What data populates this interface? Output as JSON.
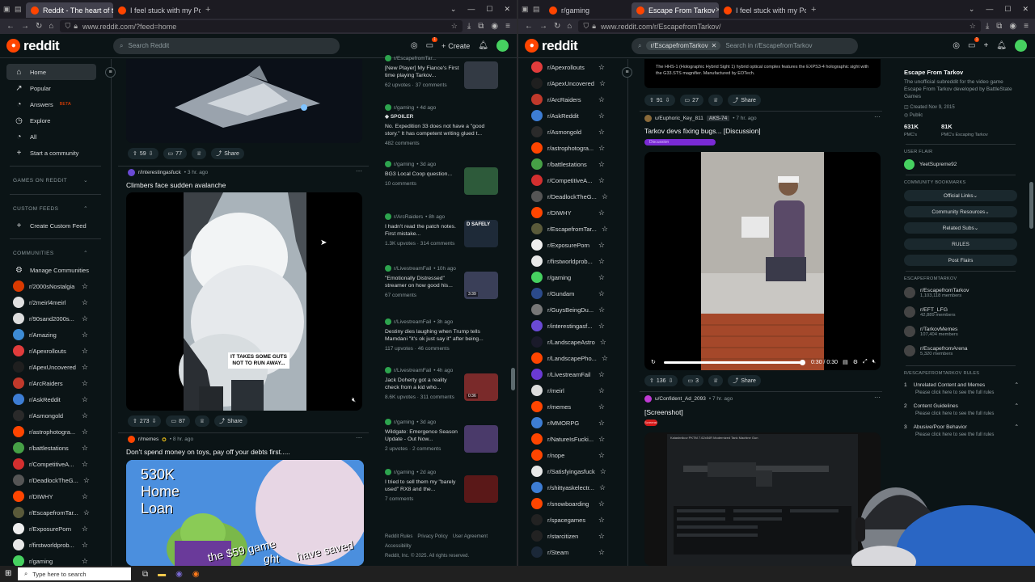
{
  "left": {
    "tabs": [
      {
        "label": "Reddit - The heart of the intern"
      },
      {
        "label": "I feel stuck with my Polaris..."
      }
    ],
    "url": "www.reddit.com/?feed=home",
    "logo": "reddit",
    "search_placeholder": "Search Reddit",
    "create_label": "Create",
    "notif_count": "1",
    "nav": [
      {
        "label": "Home",
        "icon": "home-icon"
      },
      {
        "label": "Popular",
        "icon": "popular-icon"
      },
      {
        "label": "Answers",
        "badge": "BETA",
        "icon": "answers-icon"
      },
      {
        "label": "Explore",
        "icon": "explore-icon"
      },
      {
        "label": "All",
        "icon": "all-icon"
      },
      {
        "label": "Start a community",
        "icon": "plus-icon"
      }
    ],
    "sections": {
      "games": "GAMES ON REDDIT",
      "custom_feeds": "CUSTOM FEEDS",
      "create_custom_feed": "Create Custom Feed",
      "communities": "COMMUNITIES",
      "manage": "Manage Communities"
    },
    "communities": [
      {
        "name": "r/2000sNostalgia",
        "color": "#d93a00"
      },
      {
        "name": "r/2meirl4meirl",
        "color": "#e0e0e0"
      },
      {
        "name": "r/90sand2000s...",
        "color": "#dddddd"
      },
      {
        "name": "r/Amazing",
        "color": "#3d8bd4"
      },
      {
        "name": "r/Apexrollouts",
        "color": "#e03c3c"
      },
      {
        "name": "r/ApexUncovered",
        "color": "#1f1f1f"
      },
      {
        "name": "r/ArcRaiders",
        "color": "#c0392b"
      },
      {
        "name": "r/AskReddit",
        "color": "#3d7dd4"
      },
      {
        "name": "r/Asmongold",
        "color": "#2a2a2a"
      },
      {
        "name": "r/astrophotogra...",
        "color": "#ff4500"
      },
      {
        "name": "r/battlestations",
        "color": "#46a046"
      },
      {
        "name": "r/CompetitiveA...",
        "color": "#d32f2f"
      },
      {
        "name": "r/DeadlockTheG...",
        "color": "#555555"
      },
      {
        "name": "r/DIWHY",
        "color": "#ff4500"
      },
      {
        "name": "r/EscapefromTar...",
        "color": "#5a5a3a"
      },
      {
        "name": "r/ExposurePorn",
        "color": "#eeeeee"
      },
      {
        "name": "r/firstworldprob...",
        "color": "#e8e8e8"
      },
      {
        "name": "r/gaming",
        "color": "#46d160"
      }
    ],
    "posts": [
      {
        "upvotes": "59",
        "comments": "77",
        "share": "Share"
      },
      {
        "sub": "r/interestingasfuck",
        "age": "• 3 hr. ago",
        "title": "Climbers face sudden avalanche",
        "caption": "IT TAKES SOME GUTS NOT TO RUN AWAY...",
        "upvotes": "273",
        "comments": "87",
        "share": "Share"
      },
      {
        "sub": "r/memes",
        "age": "• 8 hr. ago",
        "title": "Don't spend money on toys, pay off your debts first.....",
        "meme_lines": [
          "530K",
          "Home",
          "Loan"
        ],
        "meme_bottom": "the $59 game",
        "meme_right": "have saved",
        "meme_bottom2": "ght"
      }
    ],
    "rail": [
      {
        "sub": "r/EscapefromTar...",
        "title": "[New Player] My Fiance's First time playing Tarkov...",
        "stats": "62 upvotes · 37 comments",
        "thumb": "#333a44"
      },
      {
        "sub": "r/gaming",
        "age": "• 4d ago",
        "spoiler": "SPOILER",
        "title": "No. Expedition 33 does not have a \"good story.\" It has competent writing glued t...",
        "stats": "482 comments"
      },
      {
        "sub": "r/gaming",
        "age": "• 3d ago",
        "title": "BG3 Local Coop question...",
        "stats": "10 comments",
        "thumb": "#2d5a3a"
      },
      {
        "sub": "r/ArcRaiders",
        "age": "• 8h ago",
        "title": "I hadn't read the patch notes. First mistake...",
        "stats": "1.3K upvotes · 314 comments",
        "thumb": "#1e2a38",
        "thumb_text": "D SAFELY"
      },
      {
        "sub": "r/LivestreamFail",
        "age": "• 10h ago",
        "title": "\"Emotionally Distressed\" streamer on how good his...",
        "stats": "67 comments",
        "thumb": "#3a3f58",
        "dur": "3:39"
      },
      {
        "sub": "r/LivestreamFail",
        "age": "• 3h ago",
        "title": "Destiny dies laughing when Trump tells Mamdani \"it's ok just say it\" after being...",
        "stats": "117 upvotes · 46 comments"
      },
      {
        "sub": "r/LivestreamFail",
        "age": "• 4h ago",
        "title": "Jack Doherty got a reality check from a kid who...",
        "stats": "8.6K upvotes · 311 comments",
        "thumb": "#7a2a2a",
        "dur": "0:36"
      },
      {
        "sub": "r/gaming",
        "age": "• 3d ago",
        "title": "Wildgate: Emergence Season Update - Out Now...",
        "stats": "2 upvotes · 2 comments",
        "thumb": "#4a3a6a"
      },
      {
        "sub": "r/gaming",
        "age": "• 2d ago",
        "title": "I tried to sell them my \"barely used\" RX8 and the...",
        "stats": "7 comments",
        "thumb": "#5a1818"
      }
    ],
    "footer": {
      "links": [
        "Reddit Rules",
        "Privacy Policy",
        "User Agreement",
        "Accessibility"
      ],
      "copyright": "Reddit, Inc. © 2025. All rights reserved."
    }
  },
  "right": {
    "tabs": [
      {
        "label": "r/gaming"
      },
      {
        "label": "Escape From Tarkov"
      },
      {
        "label": "I feel stuck with my Polaris..."
      }
    ],
    "url": "www.reddit.com/r/EscapefromTarkov/",
    "logo": "reddit",
    "search_chip": "r/EscapefromTarkov",
    "search_placeholder": "Search in r/EscapefromTarkov",
    "notif_count": "1",
    "communities": [
      {
        "name": "r/Apexrollouts",
        "color": "#e03c3c"
      },
      {
        "name": "r/ApexUncovered",
        "color": "#1f1f1f"
      },
      {
        "name": "r/ArcRaiders",
        "color": "#c0392b"
      },
      {
        "name": "r/AskReddit",
        "color": "#3d7dd4"
      },
      {
        "name": "r/Asmongold",
        "color": "#2a2a2a"
      },
      {
        "name": "r/astrophotogra...",
        "color": "#ff4500"
      },
      {
        "name": "r/battlestations",
        "color": "#46a046"
      },
      {
        "name": "r/CompetitiveA...",
        "color": "#d32f2f"
      },
      {
        "name": "r/DeadlockTheG...",
        "color": "#555555"
      },
      {
        "name": "r/DIWHY",
        "color": "#ff4500"
      },
      {
        "name": "r/EscapefromTar...",
        "color": "#5a5a3a"
      },
      {
        "name": "r/ExposurePorn",
        "color": "#eeeeee"
      },
      {
        "name": "r/firstworldprob...",
        "color": "#e8e8e8"
      },
      {
        "name": "r/gaming",
        "color": "#46d160"
      },
      {
        "name": "r/Gundam",
        "color": "#2b4a8a"
      },
      {
        "name": "r/GuysBeingDu...",
        "color": "#777777"
      },
      {
        "name": "r/interestingasf...",
        "color": "#6a4ad4"
      },
      {
        "name": "r/LandscapeAstro",
        "color": "#1a1a2a"
      },
      {
        "name": "r/LandscapePho...",
        "color": "#ff4500"
      },
      {
        "name": "r/LivestreamFail",
        "color": "#6a3ad4"
      },
      {
        "name": "r/meirl",
        "color": "#dddddd"
      },
      {
        "name": "r/memes",
        "color": "#ff4500"
      },
      {
        "name": "r/MMORPG",
        "color": "#3d7dd4"
      },
      {
        "name": "r/NatureIsFucki...",
        "color": "#ff4500"
      },
      {
        "name": "r/nope",
        "color": "#ff4500"
      },
      {
        "name": "r/Satisfyingasfuck",
        "color": "#e8e8e8"
      },
      {
        "name": "r/shittyaskelectr...",
        "color": "#3d7dd4"
      },
      {
        "name": "r/snowboarding",
        "color": "#ff4500"
      },
      {
        "name": "r/spacegames",
        "color": "#222222"
      },
      {
        "name": "r/starcitizen",
        "color": "#222222"
      },
      {
        "name": "r/Steam",
        "color": "#1b2838"
      }
    ],
    "top_post": {
      "text": "The HHS-1 (Holographic Hybrid Sight 1) hybrid optical complex features the EXPS3-4 holographic sight with the G33.STS magnifier. Manufactured by EOTech.",
      "upvotes": "91",
      "comments": "27",
      "share": "Share"
    },
    "video_post": {
      "user": "u/Euphoric_Key_811",
      "flair": "AKS-74",
      "age": "• 7 hr. ago",
      "title": "Tarkov devs fixing bugs... [Discussion]",
      "tag": "Discussion",
      "time": "0:30 / 0:30",
      "progress": 1.0,
      "upvotes": "136",
      "comments": "3",
      "share": "Share"
    },
    "screenshot_post": {
      "user": "u/Confident_Ad_2093",
      "age": "• 7 hr. ago",
      "title": "[Screenshot]",
      "tag": "Screenshot",
      "weapon": "Kalashnikov PKTM 7.62x54R Modernized Tank Machine Gun"
    },
    "about": {
      "name": "Escape From Tarkov",
      "desc": "The unofficial subreddit for the video game Escape From Tarkov developed by BattleState Games",
      "created": "Created Nov 9, 2015",
      "visibility": "Public",
      "members": "631K",
      "members_label": "PMC's",
      "online": "81K",
      "online_label": "PMC's Escaping Tarkov"
    },
    "user_flair": {
      "heading": "USER FLAIR",
      "name": "YeetSupreme92"
    },
    "bookmarks": {
      "heading": "COMMUNITY BOOKMARKS",
      "items": [
        "Official Links",
        "Community Resources",
        "Related Subs",
        "RULES",
        "Post Flairs"
      ]
    },
    "related": {
      "heading": "ESCAPEFROMTARKOV",
      "items": [
        {
          "name": "r/EscapefromTarkov",
          "members": "1,103,118 members"
        },
        {
          "name": "r/EFT_LFG",
          "members": "42,889 members"
        },
        {
          "name": "r/TarkovMemes",
          "members": "107,404 members"
        },
        {
          "name": "r/EscapefromArena",
          "members": "5,320 members"
        }
      ]
    },
    "rules": {
      "heading": "R/ESCAPEFROMTARKOV RULES",
      "items": [
        {
          "n": "1",
          "label": "Unrelated Content and Memes",
          "sub": "Please click here to see the full rules"
        },
        {
          "n": "2",
          "label": "Content Guidelines",
          "sub": "Please click here to see the full rules"
        },
        {
          "n": "3",
          "label": "Abusive/Poor Behavior",
          "sub": "Please click here to see the full rules"
        }
      ]
    }
  },
  "taskbar": {
    "search_placeholder": "Type here to search"
  }
}
